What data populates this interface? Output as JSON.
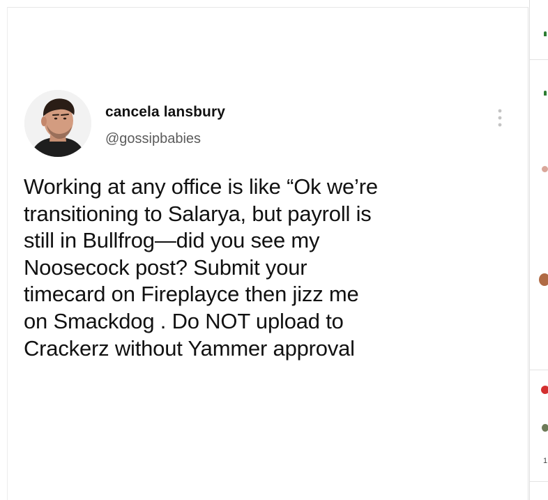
{
  "tweet": {
    "display_name": "cancela lansbury",
    "handle": "@gossipbabies",
    "more_icon": "more-vertical-icon",
    "text_lines": [
      "Working at any office is like “Ok we’re",
      "transitioning to Salarya, but payroll is",
      "still in Bullfrog—did you see my",
      "Noosecock post? Submit your",
      "timecard on Fireplayce then jizz me",
      "on Smackdog . Do NOT upload to",
      "Crackerz without Yammer approval"
    ]
  },
  "side_column": {
    "number_label": "1"
  },
  "colors": {
    "name_text": "#111111",
    "handle_text": "#5b5b5b",
    "body_text": "#111111",
    "accent_green": "#2e7d32",
    "accent_red": "#d32f2f"
  }
}
